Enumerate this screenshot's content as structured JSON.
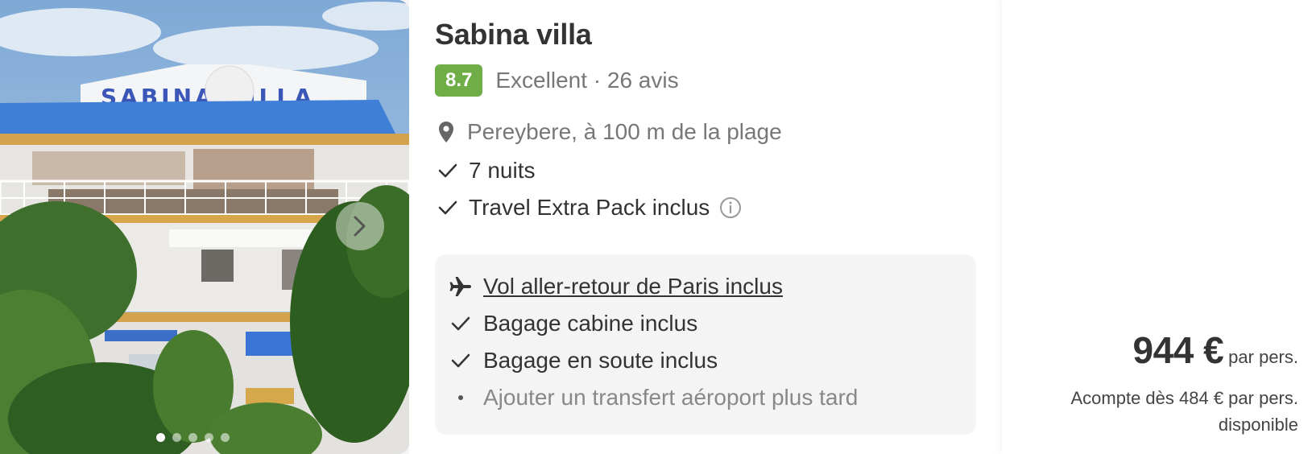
{
  "hotel": {
    "name": "Sabina villa",
    "image_sign_text": "SABINA VILLA",
    "rating_score": "8.7",
    "rating_text": "Excellent · 26 avis",
    "location": "Pereybere, à 100 m de la plage",
    "features": [
      "7 nuits",
      "Travel Extra Pack inclus"
    ]
  },
  "gallery": {
    "dots_count": 5,
    "active_dot": 0
  },
  "flight": {
    "link_label": "Vol aller-retour de Paris inclus",
    "items": [
      {
        "icon": "check-icon",
        "text": "Bagage cabine inclus"
      },
      {
        "icon": "check-icon",
        "text": "Bagage en soute inclus"
      },
      {
        "icon": "bullet-icon",
        "text": "Ajouter un transfert aéroport plus tard"
      }
    ]
  },
  "price": {
    "amount": "944 €",
    "per": "par pers.",
    "deposit_line1": "Acompte dès 484 € par pers.",
    "deposit_line2": "disponible"
  },
  "colors": {
    "rating_badge": "#6fad46",
    "text_primary": "#333333",
    "text_muted": "#777777",
    "flight_box_bg": "#f4f4f4"
  }
}
